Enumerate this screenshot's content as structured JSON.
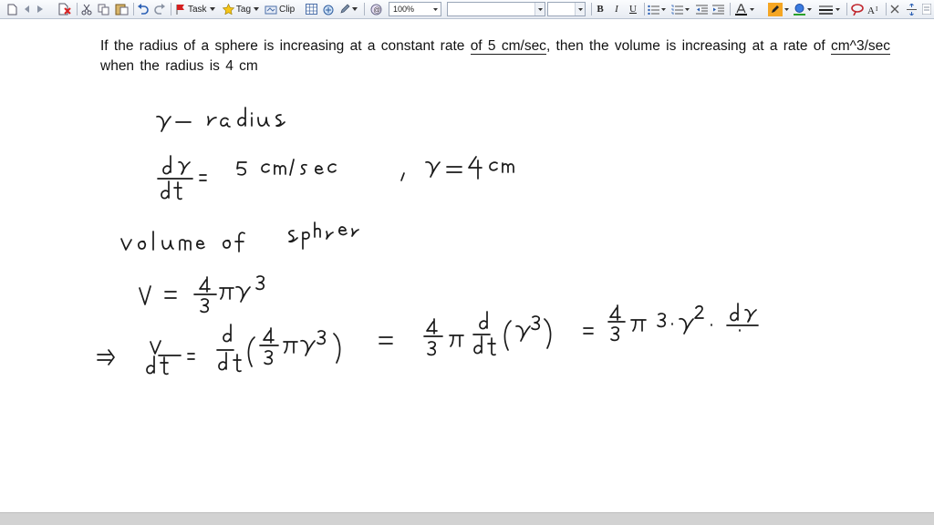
{
  "toolbar": {
    "task_label": "Task",
    "tag_label": "Tag",
    "clip_label": "Clip",
    "zoom_value": "100%",
    "font_name_value": "",
    "font_size_value": "",
    "bold_label": "B",
    "italic_label": "I",
    "underline_label": "U"
  },
  "question": {
    "part1": "If the radius of a sphere is increasing at a constant rate ",
    "rate": "of 5 cm/sec",
    "part2": ", then the volume is increasing at a rate of ",
    "unit": "cm^3/sec",
    "part3": " when the radius is 4 cm"
  },
  "handwriting": {
    "line1": "r – radius",
    "line2_lhs_num": "dr",
    "line2_lhs_den": "dt",
    "line2_rhs": "= 5 cm/sec",
    "line2_r": ", r = 4cm",
    "line3": "volume of sphere",
    "line4": "V = 4/3 π r³",
    "line5_arrow": "=>",
    "line5_lhs_num": "dV",
    "line5_lhs_den": "dt",
    "line5_step1": "= d/dt (4/3 π r³)",
    "line5_step2": "= 4/3 π d/dt (r³)",
    "line5_step3": "= 4/3 π 3·r²· dr/dt"
  }
}
